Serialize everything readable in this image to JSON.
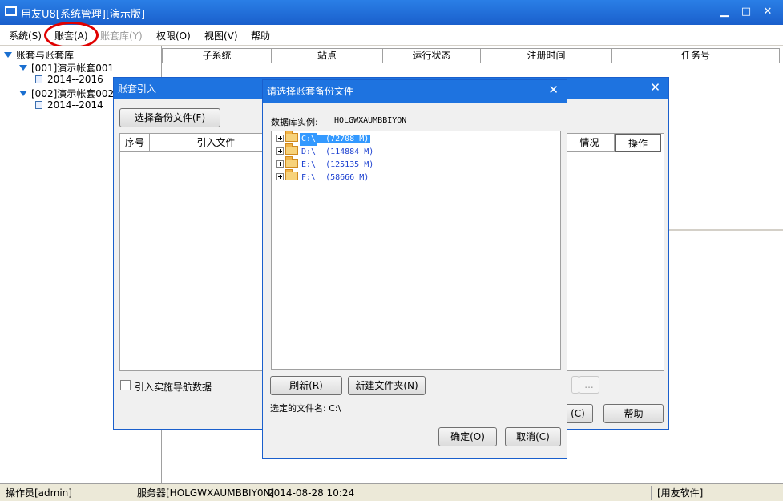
{
  "window": {
    "title": "用友U8[系统管理][演示版]",
    "minimize": "▁",
    "maximize": "□",
    "close": "✕"
  },
  "menu": [
    {
      "label": "系统(S)"
    },
    {
      "label": "账套(A)"
    },
    {
      "label": "账套库(Y)"
    },
    {
      "label": "权限(O)"
    },
    {
      "label": "视图(V)"
    },
    {
      "label": "帮助"
    }
  ],
  "tree": {
    "root": "账套与账套库",
    "accounts": [
      {
        "label": "[001]演示帐套001",
        "year": "2014--2016"
      },
      {
        "label": "[002]演示帐套002",
        "year": "2014--2014"
      }
    ]
  },
  "grid": {
    "columns": [
      "子系统",
      "站点",
      "运行状态",
      "注册时间",
      "任务号"
    ]
  },
  "status": {
    "operator": "操作员[admin]",
    "server": "服务器[HOLGWXAUMBBIY0N]",
    "datetime": "2014-08-28 10:24",
    "company": "[用友软件]"
  },
  "import_dialog": {
    "title": "账套引入",
    "close": "✕",
    "select_backup_button": "选择备份文件(F)",
    "columns": [
      "序号",
      "引入文件",
      "情况",
      "操作"
    ],
    "checkbox_label": "引入实施导航数据",
    "ellipsis_button": "...",
    "cancel_partial": "(C)",
    "help_button": "帮助"
  },
  "file_dialog": {
    "title": "请选择账套备份文件",
    "close": "✕",
    "db_instance_label": "数据库实例:",
    "db_instance_value": "HOLGWXAUMBBIYON",
    "drives": [
      {
        "name": "C:\\",
        "size": "(72708 M)"
      },
      {
        "name": "D:\\",
        "size": "(114884 M)"
      },
      {
        "name": "E:\\",
        "size": "(125135 M)"
      },
      {
        "name": "F:\\",
        "size": "(58666 M)"
      }
    ],
    "refresh_button": "刷新(R)",
    "new_folder_button": "新建文件夹(N)",
    "selected_label": "选定的文件名: C:\\",
    "ok_button": "确定(O)",
    "cancel_button": "取消(C)"
  }
}
